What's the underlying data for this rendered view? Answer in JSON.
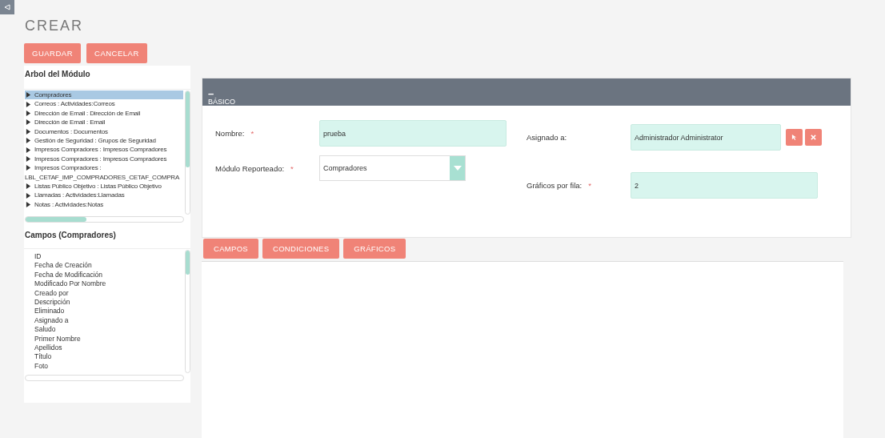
{
  "title": "CREAR",
  "actions": [
    "GUARDAR",
    "CANCELAR"
  ],
  "module_tree": {
    "heading": "Arbol del Módulo",
    "items": [
      {
        "label": "Compradores",
        "selected": true,
        "expanded": false
      },
      {
        "label": "Correos : Actividades:Correos",
        "selected": false,
        "expanded": false
      },
      {
        "label": "Dirección de Email : Dirección de Email",
        "selected": false,
        "expanded": false
      },
      {
        "label": "Dirección de Email : Email",
        "selected": false,
        "expanded": false
      },
      {
        "label": "Documentos : Documentos",
        "selected": false,
        "expanded": false
      },
      {
        "label": "Gestión de Seguridad : Grupos de Seguridad",
        "selected": false,
        "expanded": false
      },
      {
        "label": "Impresos Compradores : Impresos Compradores",
        "selected": false,
        "expanded": false
      },
      {
        "label": "Impresos Compradores : Impresos Compradores",
        "selected": false,
        "expanded": false
      },
      {
        "label": "Impresos Compradores :",
        "continuation": "LBL_CETAF_IMP_COMPRADORES_CETAF_COMPRA",
        "selected": false,
        "expanded": false
      },
      {
        "label": "Listas Público Objetivo : Listas Público Objetivo",
        "selected": false,
        "expanded": false
      },
      {
        "label": "Llamadas : Actividades:Llamadas",
        "selected": false,
        "expanded": false
      },
      {
        "label": "Notas : Actividades:Notas",
        "selected": false,
        "expanded": false
      }
    ]
  },
  "fields_list": {
    "heading": "Campos (Compradores)",
    "items": [
      "ID",
      "Fecha de Creación",
      "Fecha de Modificación",
      "Modificado Por Nombre",
      "Creado por",
      "Descripción",
      "Eliminado",
      "Asignado a",
      "Saludo",
      "Primer Nombre",
      "Apellidos",
      "Título",
      "Foto"
    ]
  },
  "panel": {
    "toggle": "–",
    "title": "BÁSICO",
    "left_fields": [
      {
        "label": "Nombre:",
        "required_mark": "*",
        "kind": "text",
        "value": "prueba"
      },
      {
        "label": "Módulo Reporteado:",
        "required_mark": "*",
        "kind": "select",
        "value": "Compradores"
      }
    ],
    "right_fields": [
      {
        "label": "Asignado a:",
        "kind": "relate",
        "value": "Administrador Administrator"
      },
      {
        "label": "Gráficos por fila:",
        "required_mark": "*",
        "kind": "text",
        "value": "2"
      }
    ]
  },
  "tabs": [
    "CAMPOS",
    "CONDICIONES",
    "GRÁFICOS"
  ]
}
